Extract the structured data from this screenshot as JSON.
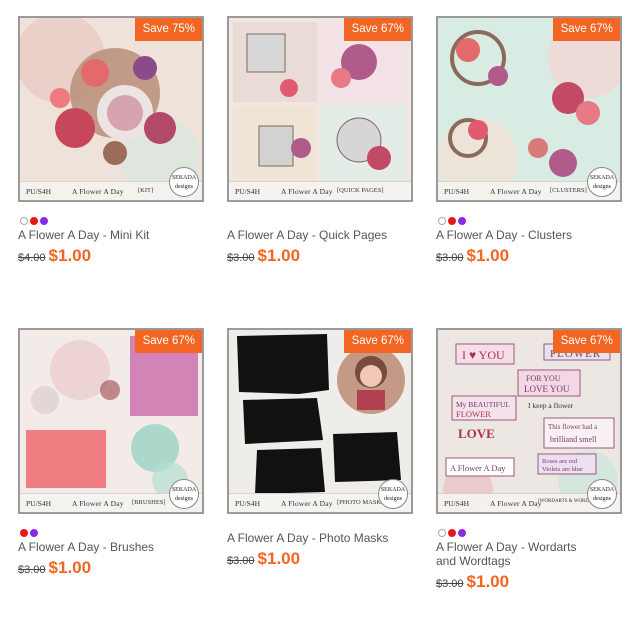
{
  "products": [
    {
      "save_badge": "Save 75%",
      "name": "A Flower A Day - Mini Kit",
      "old_price": "$4.00",
      "price": "$1.00",
      "swatches": [
        "#ffffff",
        "#e8161b",
        "#8a2be2"
      ],
      "thumb": {
        "code": "PU/S4H",
        "title": "A Flower A Day",
        "tag": "[KIT]",
        "seal": "SEKADA designs"
      }
    },
    {
      "save_badge": "Save 67%",
      "name": "A Flower A Day - Quick Pages",
      "old_price": "$3.00",
      "price": "$1.00",
      "swatches": [],
      "thumb": {
        "code": "PU/S4H",
        "title": "A Flower A Day",
        "tag": "[QUICK PAGES]",
        "seal": "SEKADA designs"
      }
    },
    {
      "save_badge": "Save 67%",
      "name": "A Flower A Day - Clusters",
      "old_price": "$3.00",
      "price": "$1.00",
      "swatches": [
        "#ffffff",
        "#e8161b",
        "#8a2be2"
      ],
      "thumb": {
        "code": "PU/S4H",
        "title": "A Flower A Day",
        "tag": "[CLUSTERS]",
        "seal": "SEKADA designs"
      }
    },
    {
      "save_badge": "Save 67%",
      "name": "A Flower A Day - Brushes",
      "old_price": "$3.00",
      "price": "$1.00",
      "swatches": [
        "#e8161b",
        "#8a2be2"
      ],
      "thumb": {
        "code": "PU/S4H",
        "title": "A Flower A Day",
        "tag": "[BRUSHES]",
        "seal": "SEKADA designs"
      }
    },
    {
      "save_badge": "Save 67%",
      "name": "A Flower A Day - Photo Masks",
      "old_price": "$3.00",
      "price": "$1.00",
      "swatches": [],
      "thumb": {
        "code": "PU/S4H",
        "title": "A Flower A Day",
        "tag": "[PHOTO MASKS]",
        "seal": "SEKADA designs"
      }
    },
    {
      "save_badge": "Save 67%",
      "name": "A Flower A Day - Wordarts and Wordtags",
      "old_price": "$3.00",
      "price": "$1.00",
      "swatches": [
        "#ffffff",
        "#e8161b",
        "#8a2be2"
      ],
      "thumb": {
        "code": "PU/S4H",
        "title": "A Flower A Day",
        "tag": "[WORDARTS & WORDTAGS]",
        "seal": "SEKADA designs",
        "wordarts": [
          "I ♥ YOU",
          "FLOWER",
          "FOR YOU",
          "LOVE YOU",
          "My BEAUTIFUL",
          "FLOWER",
          "I keep a flower",
          "This flower had a",
          "brilliand smell",
          "LOVE",
          "Roses are red",
          "Violets are blue",
          "A Flower A Day"
        ]
      }
    }
  ],
  "colors": {
    "accent": "#f26522",
    "border": "#9a9a9a"
  }
}
